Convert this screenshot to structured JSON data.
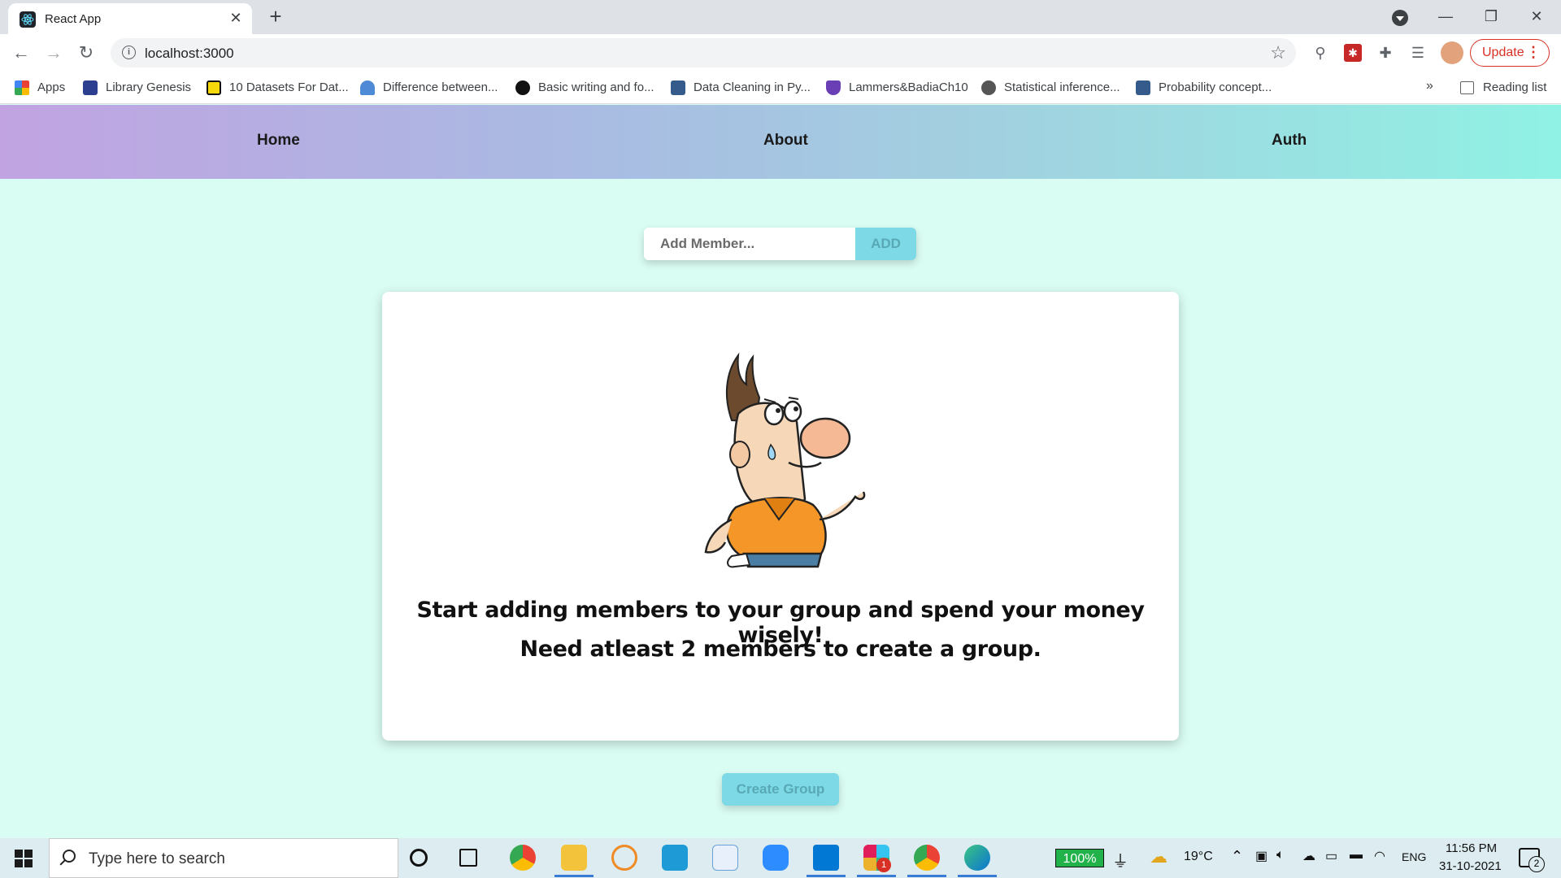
{
  "browser": {
    "tab_title": "React App",
    "url": "localhost:3000",
    "update_label": "Update",
    "bookmarks": [
      "Apps",
      "Library Genesis",
      "10 Datasets For Dat...",
      "Difference between...",
      "Basic writing and fo...",
      "Data Cleaning in Py...",
      "Lammers&BadiaCh10",
      "Statistical inference...",
      "Probability concept..."
    ],
    "more_label": "»",
    "reading_list": "Reading list"
  },
  "app": {
    "nav": [
      "Home",
      "About",
      "Auth"
    ],
    "add_placeholder": "Add Member...",
    "add_label": "ADD",
    "message_line1": "Start adding members to your group and spend your money wisely!",
    "message_line2": "Need atleast 2 members to create a group.",
    "create_label": "Create Group",
    "colors": {
      "accent": "#7dd9e6",
      "background": "#dafdf3"
    }
  },
  "taskbar": {
    "search_placeholder": "Type here to search",
    "battery": "100%",
    "temperature": "19°C",
    "language": "ENG",
    "time": "11:56 PM",
    "date": "31-10-2021",
    "notification_count": "2",
    "slack_badge": "1"
  }
}
